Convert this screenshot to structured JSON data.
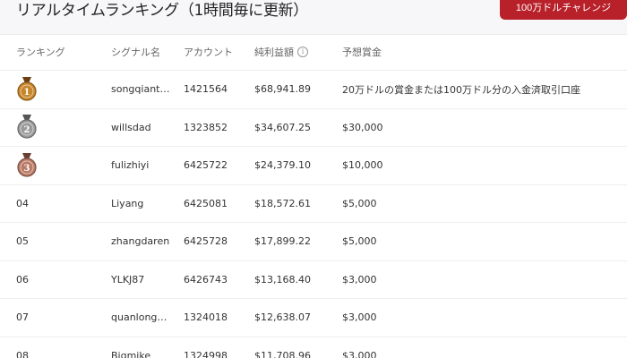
{
  "page": {
    "title": "リアルタイムランキング（1時間毎に更新）",
    "challenge_button": "100万ドルチャレンジ"
  },
  "table": {
    "headers": {
      "rank": "ランキング",
      "signal": "シグナル名",
      "account": "アカウント",
      "profit": "純利益額",
      "prize": "予想賞金"
    },
    "info_icon": "info-icon",
    "rows": [
      {
        "rank": "1",
        "signal": "songqiant…",
        "account": "1421564",
        "profit": "$68,941.89",
        "prize": "20万ドルの賞金または100万ドル分の入金済取引口座",
        "medal": "gold"
      },
      {
        "rank": "2",
        "signal": "willsdad",
        "account": "1323852",
        "profit": "$34,607.25",
        "prize": "$30,000",
        "medal": "silver"
      },
      {
        "rank": "3",
        "signal": "fulizhiyi",
        "account": "6425722",
        "profit": "$24,379.10",
        "prize": "$10,000",
        "medal": "bronze"
      },
      {
        "rank": "04",
        "signal": "Liyang",
        "account": "6425081",
        "profit": "$18,572.61",
        "prize": "$5,000"
      },
      {
        "rank": "05",
        "signal": "zhangdaren",
        "account": "6425728",
        "profit": "$17,899.22",
        "prize": "$5,000"
      },
      {
        "rank": "06",
        "signal": "YLKJ87",
        "account": "6426743",
        "profit": "$13,168.40",
        "prize": "$3,000"
      },
      {
        "rank": "07",
        "signal": "quanlong…",
        "account": "1324018",
        "profit": "$12,638.07",
        "prize": "$3,000"
      },
      {
        "rank": "08",
        "signal": "Bigmike",
        "account": "1324998",
        "profit": "$11,708.96",
        "prize": "$3,000"
      }
    ]
  },
  "colors": {
    "accent": "#b8202a",
    "gold": "#c8862a",
    "silver": "#9a9a9a",
    "bronze": "#b97a66"
  }
}
